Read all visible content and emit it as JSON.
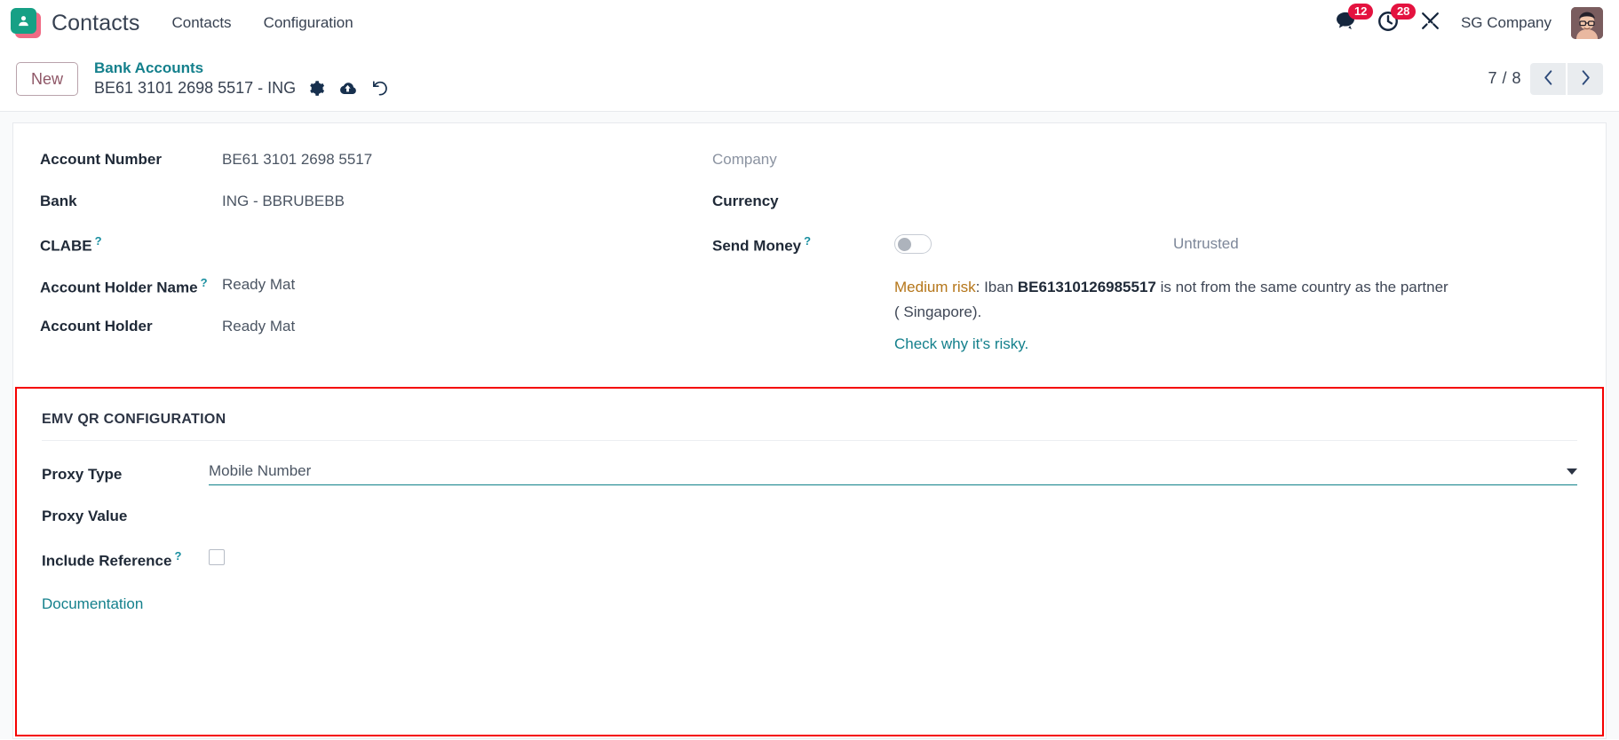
{
  "navbar": {
    "logo_icon": "contacts-app-logo",
    "app_title": "Contacts",
    "menu": [
      {
        "label": "Contacts"
      },
      {
        "label": "Configuration"
      }
    ],
    "messages": {
      "icon": "chat-bubble-icon",
      "count": "12"
    },
    "activities": {
      "icon": "clock-icon",
      "count": "28"
    },
    "debug": {
      "icon": "tools-icon"
    },
    "company": "SG Company",
    "avatar_icon": "user-avatar"
  },
  "control_panel": {
    "new_label": "New",
    "breadcrumb_parent": "Bank Accounts",
    "record_title": "BE61 3101 2698 5517 - ING",
    "icons": {
      "settings": "gear-icon",
      "save": "cloud-upload-icon",
      "discard": "undo-icon"
    },
    "pager": {
      "count": "7 / 8",
      "prev_icon": "chevron-left-icon",
      "next_icon": "chevron-right-icon"
    }
  },
  "form": {
    "left": [
      {
        "label": "Account Number",
        "value": "BE61 3101 2698 5517",
        "tooltip": false
      },
      {
        "label": "Bank",
        "value": "ING - BBRUBEBB",
        "tooltip": false
      },
      {
        "label": "CLABE",
        "value": "",
        "tooltip": true
      },
      {
        "label": "Account Holder Name",
        "value": "Ready Mat",
        "tooltip": true
      },
      {
        "label": "Account Holder",
        "value": "Ready Mat",
        "tooltip": false
      }
    ],
    "right": {
      "company": {
        "label": "Company",
        "value": ""
      },
      "currency": {
        "label": "Currency",
        "value": ""
      },
      "send_money": {
        "label": "Send Money",
        "tooltip": true,
        "toggle_state": "off",
        "trust_status": "Untrusted"
      },
      "risk": {
        "level_label": "Medium risk",
        "separator": ": Iban ",
        "iban": "BE61310126985517",
        "message_tail": " is not from the same country as the partner ( Singapore).",
        "link": "Check why it's risky."
      }
    }
  },
  "emv_section": {
    "title": "EMV QR CONFIGURATION",
    "proxy_type": {
      "label": "Proxy Type",
      "value": "Mobile Number",
      "caret_icon": "caret-down-icon"
    },
    "proxy_value": {
      "label": "Proxy Value",
      "value": ""
    },
    "include_reference": {
      "label": "Include Reference",
      "tooltip": true,
      "checked": false
    },
    "documentation_link": "Documentation"
  },
  "colors": {
    "brand_teal": "#14808c",
    "badge_red": "#e4123f",
    "highlight_red": "#f50000",
    "risk_orange": "#b5761a",
    "new_button": "#8f5767"
  }
}
